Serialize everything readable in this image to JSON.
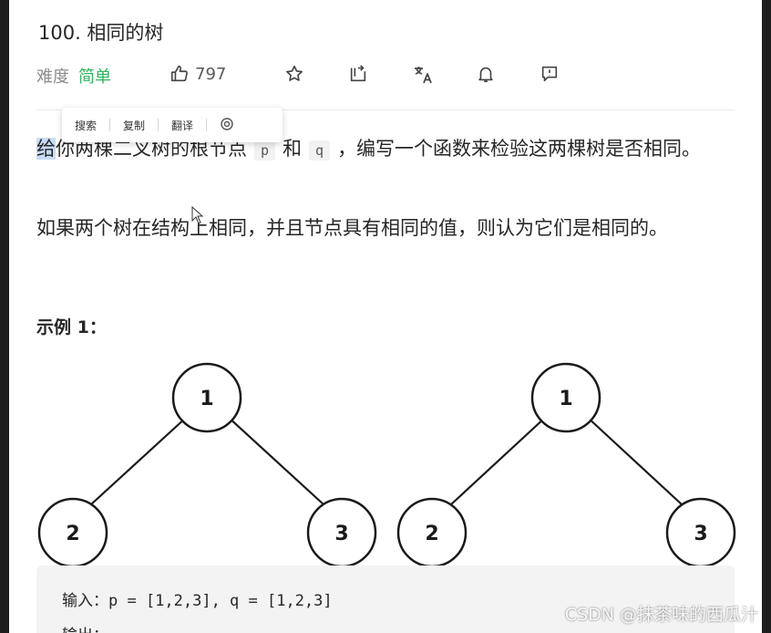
{
  "problem": {
    "title": "100. 相同的树",
    "difficulty_label": "难度",
    "difficulty_value": "简单",
    "likes": "797"
  },
  "icons": [
    "thumbs-up-icon",
    "star-icon",
    "share-icon",
    "translate-icon",
    "bell-icon",
    "feedback-icon"
  ],
  "context_menu": {
    "search": "搜索",
    "copy": "复制",
    "translate": "翻译"
  },
  "description": {
    "p1_selected": "给",
    "p1_a": "你两棵二叉树的根节点",
    "p1_code_p": "p",
    "p1_and": "和",
    "p1_code_q": "q",
    "p1_b": "，编写一个函数来检验这两棵树是否相同。",
    "p2": "如果两个树在结构上相同，并且节点具有相同的值，则认为它们是相同的。"
  },
  "example": {
    "heading": "示例 1：",
    "tree1": {
      "root": "1",
      "left": "2",
      "right": "3"
    },
    "tree2": {
      "root": "1",
      "left": "2",
      "right": "3"
    },
    "input_line": "输入：p = [1,2,3], q = [1,2,3]",
    "output_line": "输出："
  },
  "watermark": "CSDN @抹茶味的西瓜汁",
  "colors": {
    "easy": "#2db55d",
    "text": "#262626",
    "muted": "#8c8c8c",
    "code_bg": "#f2f2f2"
  }
}
